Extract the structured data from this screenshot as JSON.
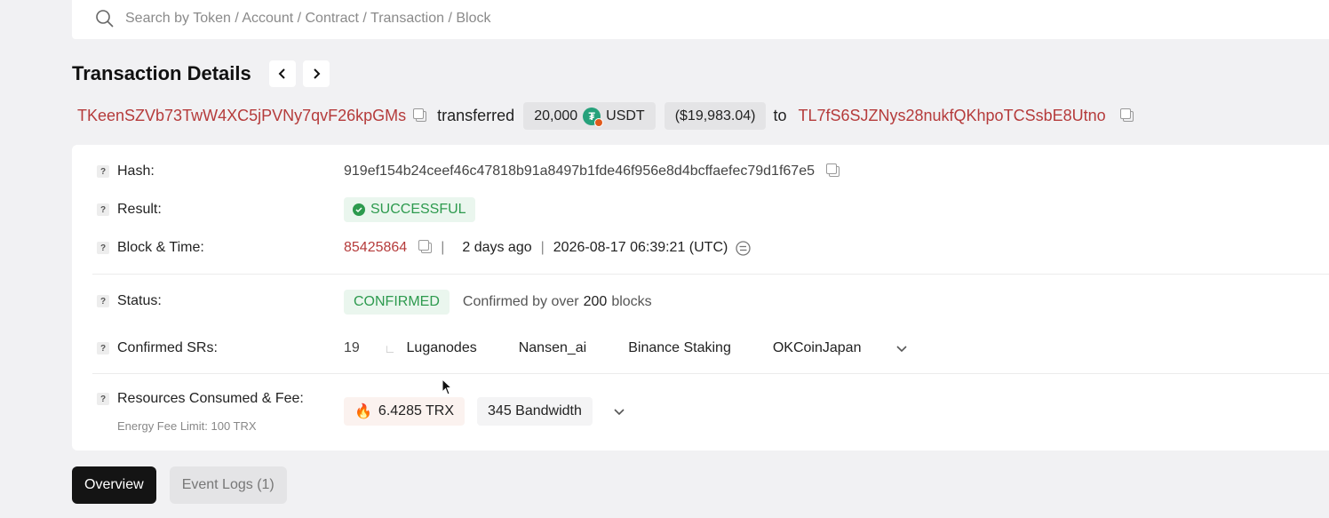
{
  "search": {
    "placeholder": "Search by Token / Account / Contract / Transaction / Block"
  },
  "header": {
    "title": "Transaction Details"
  },
  "summary": {
    "from": "TKeenSZVb73TwW4XC5jPVNy7qvF26kpGMs",
    "verb": "transferred",
    "amount": "20,000",
    "token": "USDT",
    "usd_value": "($19,983.04)",
    "to_word": "to",
    "to": "TL7fS6SJZNys28nukfQKhpoTCSsbE8Utno"
  },
  "details": {
    "hash_label": "Hash:",
    "hash": "919ef154b24ceef46c47818b91a8497b1fde46f956e8d4bcffaefec79d1f67e5",
    "result_label": "Result:",
    "result": "SUCCESSFUL",
    "block_time_label": "Block & Time:",
    "block": "85425864",
    "age": "2 days ago",
    "timestamp": "2026-08-17 06:39:21 (UTC)",
    "status_label": "Status:",
    "status": "CONFIRMED",
    "confirmed_prefix": "Confirmed by over",
    "confirmed_count": "200",
    "confirmed_suffix": "blocks",
    "srs_label": "Confirmed SRs:",
    "srs_count": "19",
    "srs": [
      "Luganodes",
      "Nansen_ai",
      "Binance Staking",
      "OKCoinJapan"
    ],
    "resources_label": "Resources Consumed & Fee:",
    "energy_limit": "Energy Fee Limit: 100 TRX",
    "fee": "6.4285 TRX",
    "bandwidth": "345 Bandwidth"
  },
  "tabs": [
    {
      "label": "Overview"
    },
    {
      "label": "Event Logs (1)"
    }
  ],
  "colors": {
    "address": "#b53b3b",
    "success": "#2d9a4e",
    "tab_active": "#141414"
  }
}
